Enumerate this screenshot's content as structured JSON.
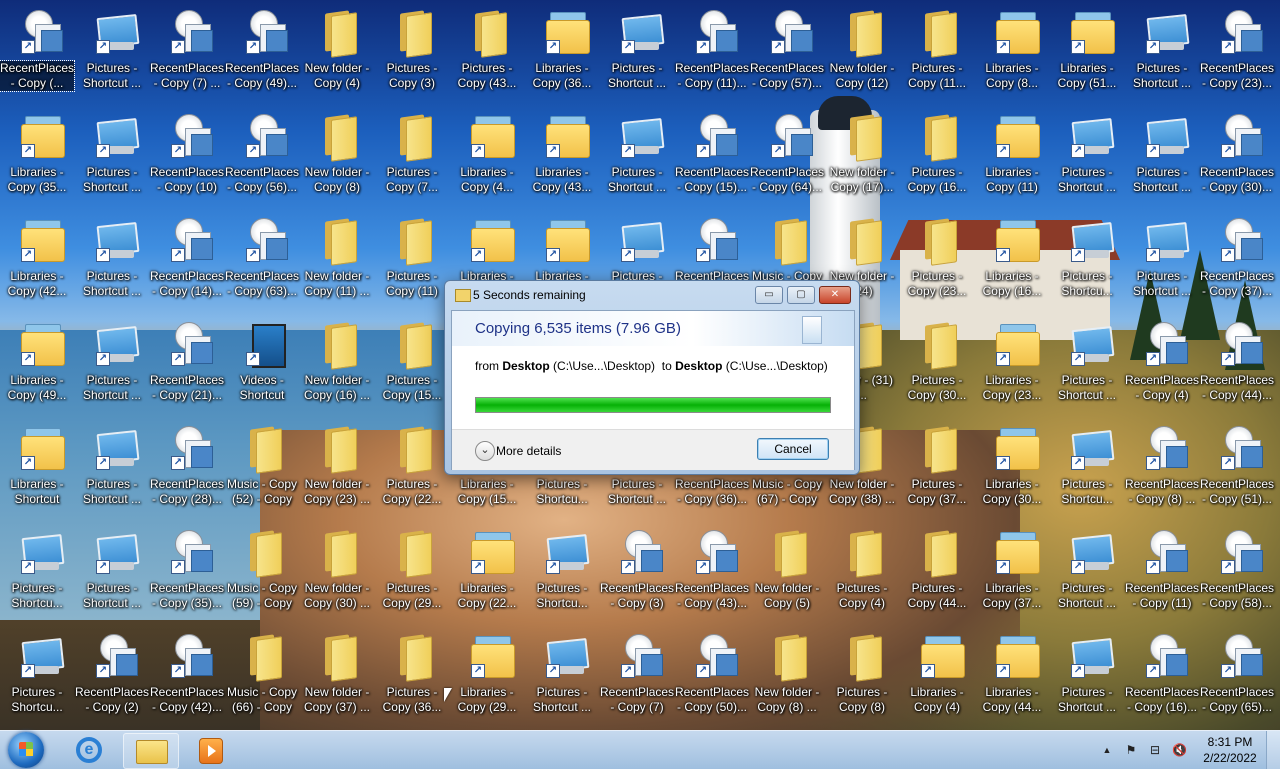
{
  "desktop": {
    "icons": [
      {
        "type": "recent",
        "label": "RecentPlaces - Copy (...",
        "x": 0,
        "y": 0,
        "selected": true
      },
      {
        "type": "pictures",
        "label": "Pictures - Shortcut ..."
      },
      {
        "type": "recent",
        "label": "RecentPlaces - Copy (7) ..."
      },
      {
        "type": "recent",
        "label": "RecentPlaces - Copy (49)..."
      },
      {
        "type": "folder",
        "label": "New folder - Copy (4)"
      },
      {
        "type": "folder",
        "label": "Pictures - Copy (3)"
      },
      {
        "type": "folder",
        "label": "Pictures - Copy (43..."
      },
      {
        "type": "library",
        "label": "Libraries - Copy (36..."
      },
      {
        "type": "pictures",
        "label": "Pictures - Shortcut ..."
      },
      {
        "type": "recent",
        "label": "RecentPlaces - Copy (11)..."
      },
      {
        "type": "recent",
        "label": "RecentPlaces - Copy (57)..."
      },
      {
        "type": "folder",
        "label": "New folder - Copy (12)"
      },
      {
        "type": "folder",
        "label": "Pictures - Copy (11..."
      },
      {
        "type": "library",
        "label": "Libraries - Copy (8..."
      },
      {
        "type": "library",
        "label": "Libraries - Copy (51..."
      },
      {
        "type": "pictures",
        "label": "Pictures - Shortcut ..."
      },
      {
        "type": "recent",
        "label": "RecentPlaces - Copy (23)..."
      },
      {
        "type": "library",
        "label": "Libraries - Copy (35..."
      },
      {
        "type": "pictures",
        "label": "Pictures - Shortcut ..."
      },
      {
        "type": "recent",
        "label": "RecentPlaces - Copy (10)"
      },
      {
        "type": "recent",
        "label": "RecentPlaces - Copy (56)..."
      },
      {
        "type": "folder",
        "label": "New folder - Copy (8)"
      },
      {
        "type": "folder",
        "label": "Pictures - Copy (7..."
      },
      {
        "type": "library",
        "label": "Libraries - Copy (4..."
      },
      {
        "type": "library",
        "label": "Libraries - Copy (43..."
      },
      {
        "type": "pictures",
        "label": "Pictures - Shortcut ..."
      },
      {
        "type": "recent",
        "label": "RecentPlaces - Copy (15)..."
      },
      {
        "type": "recent",
        "label": "RecentPlaces - Copy (64)..."
      },
      {
        "type": "folder",
        "label": "New folder - Copy (17)..."
      },
      {
        "type": "folder",
        "label": "Pictures - Copy (16..."
      },
      {
        "type": "library",
        "label": "Libraries - Copy (11)"
      },
      {
        "type": "pictures",
        "label": "Pictures - Shortcut ..."
      },
      {
        "type": "pictures",
        "label": "Pictures - Shortcut ..."
      },
      {
        "type": "recent",
        "label": "RecentPlaces - Copy (30)..."
      },
      {
        "type": "library",
        "label": "Libraries - Copy (42..."
      },
      {
        "type": "pictures",
        "label": "Pictures - Shortcut ..."
      },
      {
        "type": "recent",
        "label": "RecentPlaces - Copy (14)..."
      },
      {
        "type": "recent",
        "label": "RecentPlaces - Copy (63)..."
      },
      {
        "type": "folder",
        "label": "New folder - Copy (11) ..."
      },
      {
        "type": "folder",
        "label": "Pictures - Copy (11)"
      },
      {
        "type": "library",
        "label": "Libraries -"
      },
      {
        "type": "library",
        "label": "Libraries -"
      },
      {
        "type": "pictures",
        "label": "Pictures -"
      },
      {
        "type": "recent",
        "label": "RecentPlaces"
      },
      {
        "type": "folder",
        "label": "Music - Copy"
      },
      {
        "type": "folder",
        "label": "New folder - (24)"
      },
      {
        "type": "folder",
        "label": "Pictures - Copy (23..."
      },
      {
        "type": "library",
        "label": "Libraries - Copy (16..."
      },
      {
        "type": "pictures",
        "label": "Pictures - Shortcu..."
      },
      {
        "type": "pictures",
        "label": "Pictures - Shortcut ..."
      },
      {
        "type": "recent",
        "label": "RecentPlaces - Copy (37)..."
      },
      {
        "type": "library",
        "label": "Libraries - Copy (49..."
      },
      {
        "type": "pictures",
        "label": "Pictures - Shortcut ..."
      },
      {
        "type": "recent",
        "label": "RecentPlaces - Copy (21)..."
      },
      {
        "type": "video",
        "label": "Videos - Shortcut"
      },
      {
        "type": "folder",
        "label": "New folder - Copy (16) ..."
      },
      {
        "type": "folder",
        "label": "Pictures - Copy (15..."
      },
      {
        "type": "folder",
        "label": "folder - (31) ..."
      },
      {
        "type": "folder",
        "label": "Pictures - Copy (30..."
      },
      {
        "type": "library",
        "label": "Libraries - Copy (23..."
      },
      {
        "type": "pictures",
        "label": "Pictures - Shortcut ..."
      },
      {
        "type": "recent",
        "label": "RecentPlaces - Copy (4)"
      },
      {
        "type": "recent",
        "label": "RecentPlaces - Copy (44)..."
      },
      {
        "type": "library",
        "label": "Libraries - Shortcut"
      },
      {
        "type": "pictures",
        "label": "Pictures - Shortcut ..."
      },
      {
        "type": "recent",
        "label": "RecentPlaces - Copy (28)..."
      },
      {
        "type": "folder",
        "label": "Music - Copy (52) - Copy"
      },
      {
        "type": "folder",
        "label": "New folder - Copy (23) ..."
      },
      {
        "type": "folder",
        "label": "Pictures - Copy (22..."
      },
      {
        "type": "library",
        "label": "Libraries - Copy (15..."
      },
      {
        "type": "pictures",
        "label": "Pictures - Shortcu..."
      },
      {
        "type": "pictures",
        "label": "Pictures - Shortcut ..."
      },
      {
        "type": "recent",
        "label": "RecentPlaces - Copy (36)..."
      },
      {
        "type": "folder",
        "label": "Music - Copy (67) - Copy"
      },
      {
        "type": "folder",
        "label": "New folder - Copy (38) ..."
      },
      {
        "type": "folder",
        "label": "Pictures - Copy (37..."
      },
      {
        "type": "library",
        "label": "Libraries - Copy (30..."
      },
      {
        "type": "pictures",
        "label": "Pictures - Shortcu..."
      },
      {
        "type": "recent",
        "label": "RecentPlaces - Copy (8) ..."
      },
      {
        "type": "recent",
        "label": "RecentPlaces - Copy (51)..."
      },
      {
        "type": "pictures",
        "label": "Pictures - Shortcu..."
      },
      {
        "type": "pictures",
        "label": "Pictures - Shortcut ..."
      },
      {
        "type": "recent",
        "label": "RecentPlaces - Copy (35)..."
      },
      {
        "type": "folder",
        "label": "Music - Copy (59) - Copy"
      },
      {
        "type": "folder",
        "label": "New folder - Copy (30) ..."
      },
      {
        "type": "folder",
        "label": "Pictures - Copy (29..."
      },
      {
        "type": "library",
        "label": "Libraries - Copy (22..."
      },
      {
        "type": "pictures",
        "label": "Pictures - Shortcu..."
      },
      {
        "type": "recent",
        "label": "RecentPlaces - Copy (3)"
      },
      {
        "type": "recent",
        "label": "RecentPlaces - Copy (43)..."
      },
      {
        "type": "folder",
        "label": "New folder - Copy (5)"
      },
      {
        "type": "folder",
        "label": "Pictures - Copy (4)"
      },
      {
        "type": "folder",
        "label": "Pictures - Copy (44..."
      },
      {
        "type": "library",
        "label": "Libraries - Copy (37..."
      },
      {
        "type": "pictures",
        "label": "Pictures - Shortcut ..."
      },
      {
        "type": "recent",
        "label": "RecentPlaces - Copy (11)"
      },
      {
        "type": "recent",
        "label": "RecentPlaces - Copy (58)..."
      },
      {
        "type": "pictures",
        "label": "Pictures - Shortcu..."
      },
      {
        "type": "recent",
        "label": "RecentPlaces - Copy (2)"
      },
      {
        "type": "recent",
        "label": "RecentPlaces - Copy (42)..."
      },
      {
        "type": "folder",
        "label": "Music - Copy (66) - Copy"
      },
      {
        "type": "folder",
        "label": "New folder - Copy (37) ..."
      },
      {
        "type": "folder",
        "label": "Pictures - Copy (36..."
      },
      {
        "type": "library",
        "label": "Libraries - Copy (29..."
      },
      {
        "type": "pictures",
        "label": "Pictures - Shortcut ..."
      },
      {
        "type": "recent",
        "label": "RecentPlaces - Copy (7)"
      },
      {
        "type": "recent",
        "label": "RecentPlaces - Copy (50)..."
      },
      {
        "type": "folder",
        "label": "New folder - Copy (8) ..."
      },
      {
        "type": "folder",
        "label": "Pictures - Copy (8)"
      },
      {
        "type": "library",
        "label": "Libraries - Copy (4)"
      },
      {
        "type": "library",
        "label": "Libraries - Copy (44..."
      },
      {
        "type": "pictures",
        "label": "Pictures - Shortcut ..."
      },
      {
        "type": "recent",
        "label": "RecentPlaces - Copy (16)..."
      },
      {
        "type": "recent",
        "label": "RecentPlaces - Copy (65)..."
      }
    ]
  },
  "dialog": {
    "title": "5 Seconds remaining",
    "heading": "Copying 6,535 items (7.96 GB)",
    "from_word": "from",
    "source_name": "Desktop",
    "source_path": "(C:\\Use...\\Desktop)",
    "to_word": "to",
    "dest_name": "Desktop",
    "dest_path": "(C:\\Use...\\Desktop)",
    "progress": 1.0,
    "more_details": "More details",
    "cancel": "Cancel",
    "minimize_glyph": "▭",
    "maximize_glyph": "▢",
    "close_glyph": "✕"
  },
  "taskbar": {
    "pinned": [
      {
        "name": "internet-explorer",
        "icon": "ie-icon"
      },
      {
        "name": "windows-explorer",
        "icon": "folder-icon"
      },
      {
        "name": "media-player",
        "icon": "media-player-icon"
      }
    ],
    "tray": {
      "show_hidden_glyph": "▲",
      "flag_glyph": "⚑",
      "network_glyph": "⊟",
      "volume_glyph": "🔇",
      "time": "8:31 PM",
      "date": "2/22/2022"
    }
  },
  "colors": {
    "progress_green": "#06b006",
    "dialog_heading": "#1e3287",
    "cancel_border": "#3c7fb1"
  }
}
